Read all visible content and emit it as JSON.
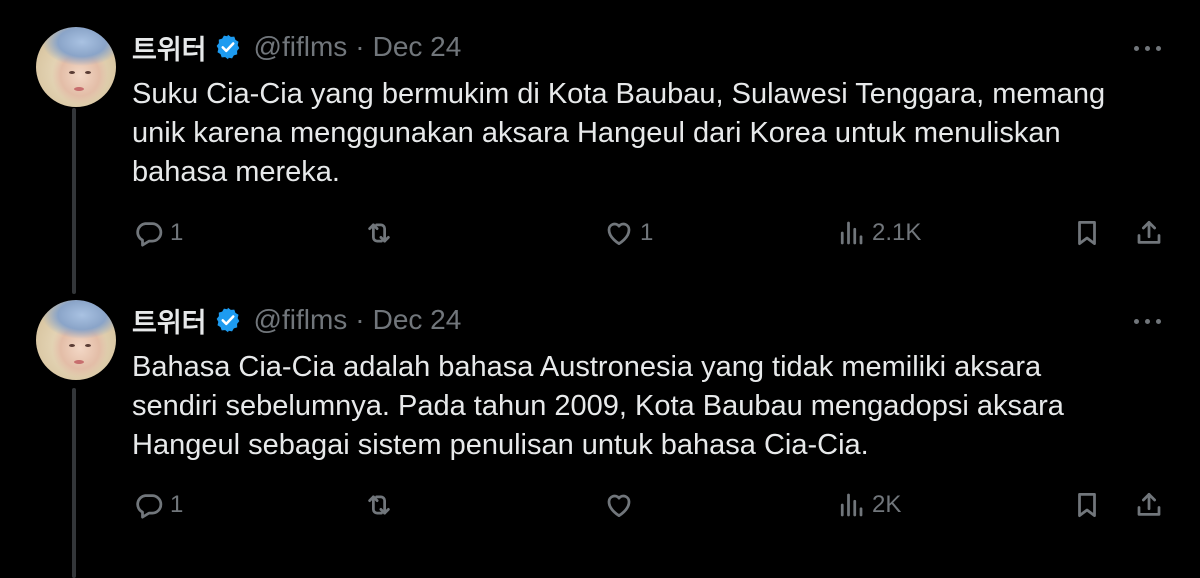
{
  "tweets": [
    {
      "display_name": "트위터",
      "handle": "@fiflms",
      "separator": "·",
      "date": "Dec 24",
      "text_lines": [
        "Suku Cia-Cia yang bermukim di Kota Baubau, Sulawesi Tenggara, memang",
        "unik karena menggunakan aksara Hangeul dari Korea untuk menuliskan",
        "bahasa mereka."
      ],
      "reply_count": "1",
      "retweet_count": "",
      "like_count": "1",
      "view_count": "2.1K"
    },
    {
      "display_name": "트위터",
      "handle": "@fiflms",
      "separator": "·",
      "date": "Dec 24",
      "text_lines": [
        "Bahasa Cia-Cia adalah bahasa Austronesia yang tidak memiliki aksara",
        "sendiri sebelumnya. Pada tahun 2009, Kota Baubau mengadopsi aksara",
        "Hangeul sebagai sistem penulisan untuk bahasa Cia-Cia."
      ],
      "reply_count": "1",
      "retweet_count": "",
      "like_count": "",
      "view_count": "2K"
    }
  ],
  "colors": {
    "background": "#000000",
    "text": "#e7e9ea",
    "secondary": "#71767b",
    "verified": "#1d9bf0",
    "thread_line": "#333639"
  }
}
